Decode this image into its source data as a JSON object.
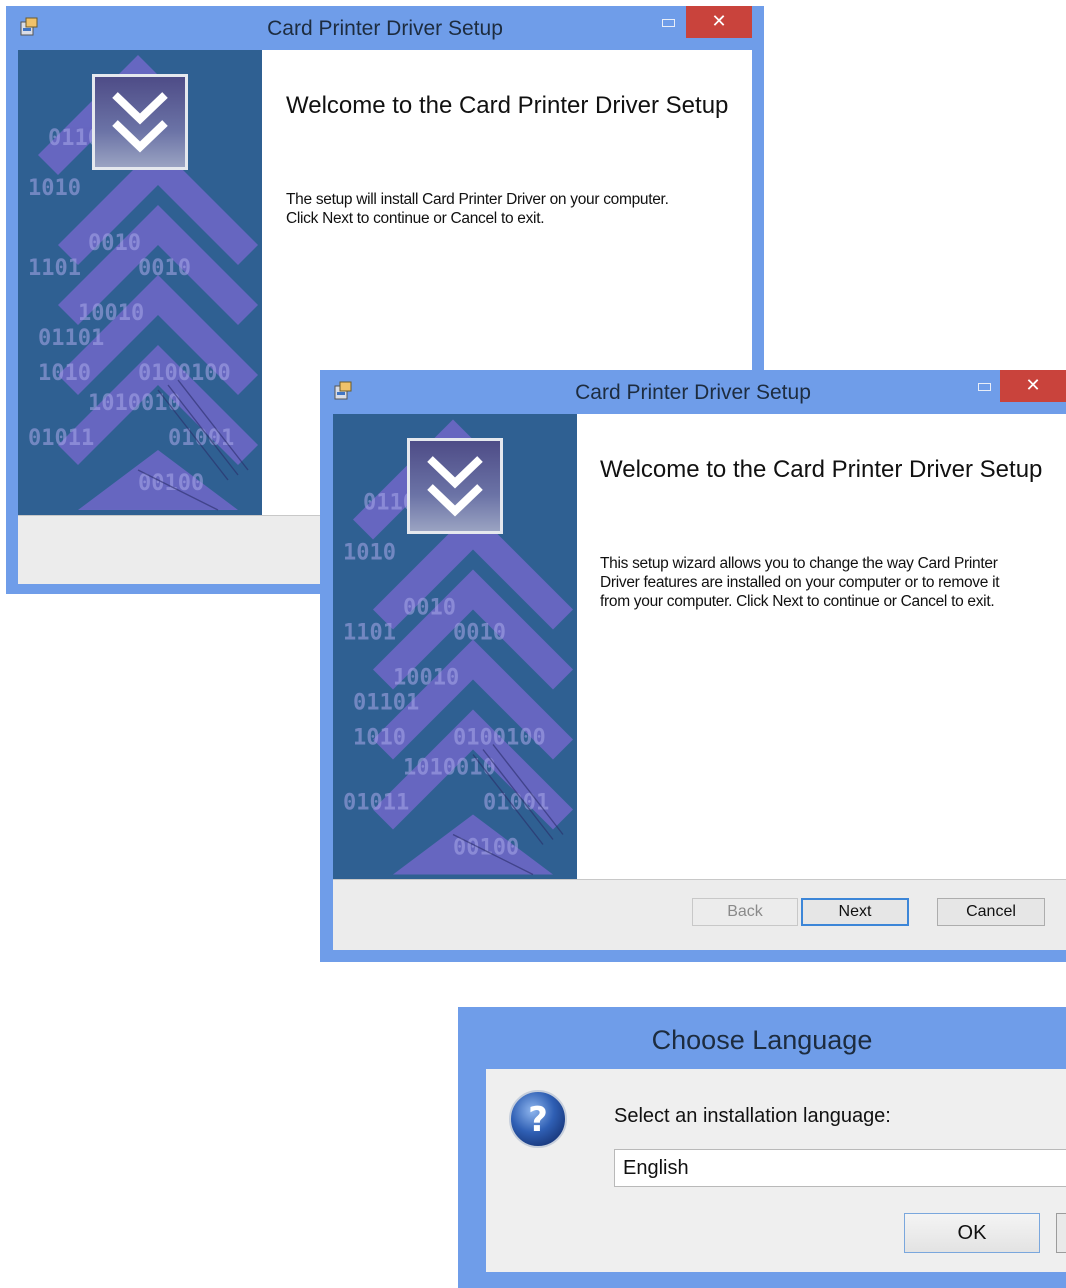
{
  "window1": {
    "title": "Card Printer Driver Setup",
    "close_label": "✕",
    "heading": "Welcome to the Card Printer Driver Setup",
    "body_line1": "The setup will install Card Printer Driver on your computer.",
    "body_line2": "Click Next to continue or Cancel to exit."
  },
  "window2": {
    "title": "Card Printer Driver Setup",
    "close_label": "✕",
    "heading": "Welcome to the Card Printer Driver Setup",
    "body_line1": "This setup wizard allows you to change the way Card Printer",
    "body_line2": "Driver features are installed on your computer or to remove it",
    "body_line3": "from your computer. Click Next to continue or Cancel to exit.",
    "buttons": {
      "back": "Back",
      "next": "Next",
      "cancel": "Cancel"
    }
  },
  "language_dialog": {
    "title": "Choose Language",
    "prompt": "Select an installation language:",
    "selected_language": "English",
    "ok_label": "OK"
  },
  "colors": {
    "window_frame": "#6f9de9",
    "close_button": "#c9433c",
    "banner": "#2f6092",
    "banner_chevrons": "#6a6fc6",
    "default_button_border": "#3c86d8"
  },
  "icons": {
    "app_icon": "installer-icon",
    "logo": "double-chevron-down-icon",
    "help": "question-mark-icon"
  }
}
